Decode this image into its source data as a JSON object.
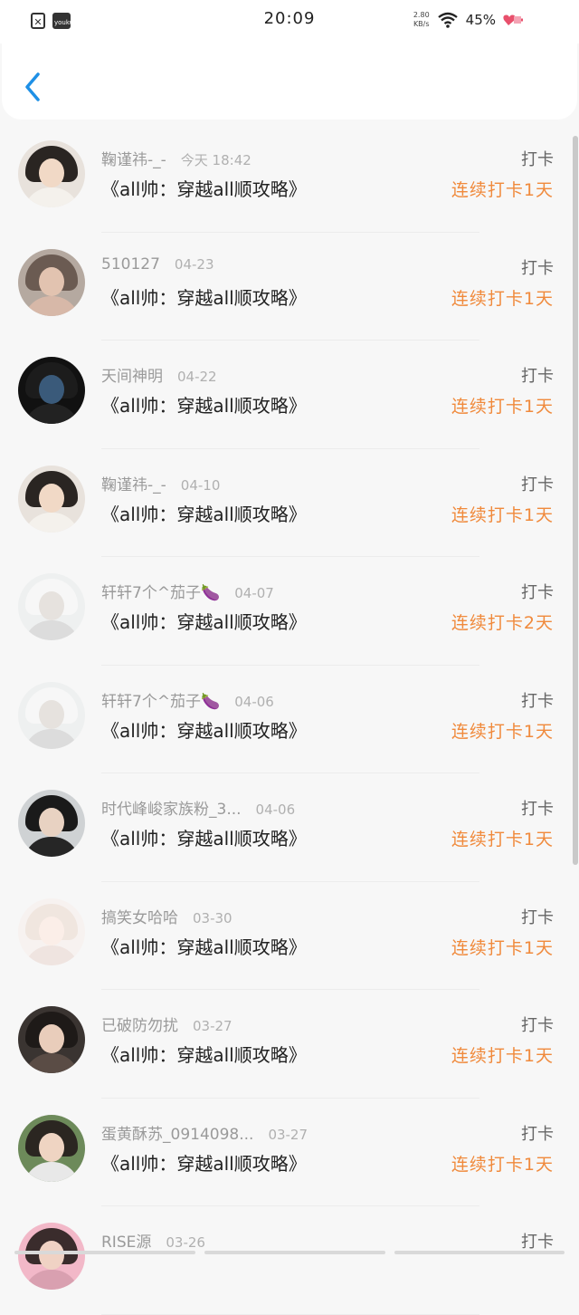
{
  "status_bar": {
    "time": "20:09",
    "net_speed_top": "2.80",
    "net_speed_bottom": "KB/s",
    "battery": "45%",
    "app_icon_label": "youku"
  },
  "colors": {
    "accent_back": "#1e90e6",
    "streak_orange": "#f08a3c"
  },
  "items": [
    {
      "name": "鞠谨祎-_-",
      "date": "今天 18:42",
      "title": "《all帅：穿越all顺攻略》",
      "checkin": "打卡",
      "streak": "连续打卡1天",
      "avatar": {
        "bg": "#e8e2dc",
        "hair": "#2a2522",
        "face": "#f1d9c6",
        "body": "#f4f1ec"
      }
    },
    {
      "name": "510127",
      "date": "04-23",
      "title": "《all帅：穿越all顺攻略》",
      "checkin": "打卡",
      "streak": "连续打卡1天",
      "avatar": {
        "bg": "#b5a9a0",
        "hair": "#6b5b52",
        "face": "#e2c3b0",
        "body": "#d7b8a8"
      }
    },
    {
      "name": "天间神明",
      "date": "04-22",
      "title": "《all帅：穿越all顺攻略》",
      "checkin": "打卡",
      "streak": "连续打卡1天",
      "avatar": {
        "bg": "#111111",
        "hair": "#1c1c1c",
        "face": "#3a5a7a",
        "body": "#222222"
      }
    },
    {
      "name": "鞠谨祎-_-",
      "date": "04-10",
      "title": "《all帅：穿越all顺攻略》",
      "checkin": "打卡",
      "streak": "连续打卡1天",
      "avatar": {
        "bg": "#e8e2dc",
        "hair": "#2a2522",
        "face": "#f1d9c6",
        "body": "#f4f1ec"
      }
    },
    {
      "name": "轩轩7个^茄子🍆",
      "date": "04-07",
      "title": "《all帅：穿越all顺攻略》",
      "checkin": "打卡",
      "streak": "连续打卡2天",
      "avatar": {
        "bg": "#eef0f0",
        "hair": "#f7f7f7",
        "face": "#e6e2de",
        "body": "#dcdcdc"
      }
    },
    {
      "name": "轩轩7个^茄子🍆",
      "date": "04-06",
      "title": "《all帅：穿越all顺攻略》",
      "checkin": "打卡",
      "streak": "连续打卡1天",
      "avatar": {
        "bg": "#eef0f0",
        "hair": "#f7f7f7",
        "face": "#e6e2de",
        "body": "#dcdcdc"
      }
    },
    {
      "name": "时代峰峻家族粉_3...",
      "date": "04-06",
      "title": "《all帅：穿越all顺攻略》",
      "checkin": "打卡",
      "streak": "连续打卡1天",
      "avatar": {
        "bg": "#cfd2d4",
        "hair": "#1a1a1a",
        "face": "#e8d2c2",
        "body": "#262626"
      }
    },
    {
      "name": "搞笑女哈哈",
      "date": "03-30",
      "title": "《all帅：穿越all顺攻略》",
      "checkin": "打卡",
      "streak": "连续打卡1天",
      "avatar": {
        "bg": "#f7f2f0",
        "hair": "#f0e6df",
        "face": "#fbeee8",
        "body": "#efe4e0"
      }
    },
    {
      "name": "已破防勿扰",
      "date": "03-27",
      "title": "《all帅：穿越all顺攻略》",
      "checkin": "打卡",
      "streak": "连续打卡1天",
      "avatar": {
        "bg": "#3a3431",
        "hair": "#1e1a18",
        "face": "#e9cdbb",
        "body": "#5a4c45"
      }
    },
    {
      "name": "蛋黄酥苏_0914098...",
      "date": "03-27",
      "title": "《all帅：穿越all顺攻略》",
      "checkin": "打卡",
      "streak": "连续打卡1天",
      "avatar": {
        "bg": "#6d8a5a",
        "hair": "#2b2621",
        "face": "#efd4c2",
        "body": "#e8e8e8"
      }
    },
    {
      "name": "RISE源",
      "date": "03-26",
      "title": "",
      "checkin": "打卡",
      "streak": "",
      "avatar": {
        "bg": "#f2b8c8",
        "hair": "#3a2c2c",
        "face": "#f0d2c4",
        "body": "#d9a0b0"
      }
    }
  ]
}
